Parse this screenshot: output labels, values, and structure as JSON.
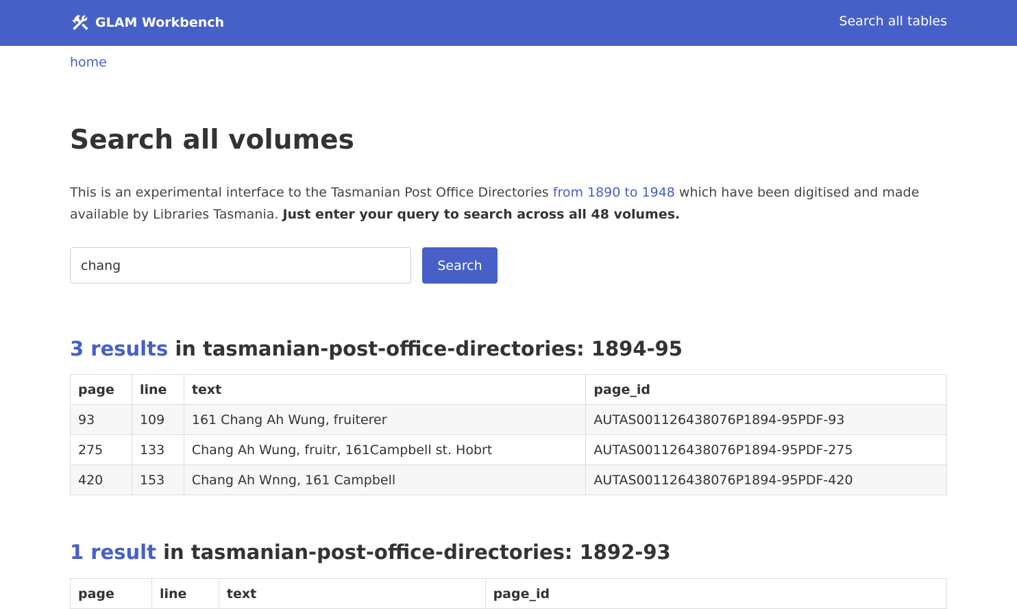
{
  "header": {
    "brand": "GLAM Workbench",
    "brand_icon": "tools-icon",
    "nav_link": "Search all tables"
  },
  "breadcrumb": {
    "home": "home"
  },
  "main": {
    "title": "Search all volumes",
    "intro": {
      "part1": "This is an experimental interface to the Tasmanian Post Office Directories ",
      "link": "from 1890 to 1948",
      "part2": " which have been digitised and made available by Libraries Tasmania. ",
      "bold": "Just enter your query to search across all 48 volumes."
    },
    "search": {
      "value": "chang",
      "button_label": "Search"
    }
  },
  "results": [
    {
      "count_label": "3 results",
      "heading_rest": " in tasmanian-post-office-directories: 1894-95",
      "columns": [
        "page",
        "line",
        "text",
        "page_id"
      ],
      "rows": [
        [
          "93",
          "109",
          "161 Chang Ah Wung, fruiterer",
          "AUTAS001126438076P1894-95PDF-93"
        ],
        [
          "275",
          "133",
          "Chang Ah Wung, fruitr, 161Campbell st. Hobrt",
          "AUTAS001126438076P1894-95PDF-275"
        ],
        [
          "420",
          "153",
          "Chang Ah Wnng, 161 Campbell",
          "AUTAS001126438076P1894-95PDF-420"
        ]
      ]
    },
    {
      "count_label": "1 result",
      "heading_rest": " in tasmanian-post-office-directories: 1892-93",
      "columns": [
        "page",
        "line",
        "text",
        "page_id"
      ]
    }
  ],
  "colors": {
    "accent": "#4660c7",
    "text": "#333333",
    "row_stripe": "#f7f7f7",
    "border": "#dddddd"
  }
}
